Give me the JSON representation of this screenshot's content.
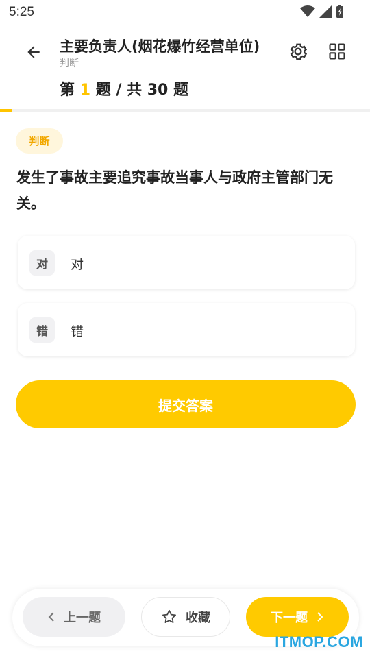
{
  "status_bar": {
    "time": "5:25"
  },
  "header": {
    "title": "主要负责人(烟花爆竹经营单位)",
    "subtitle": "判断",
    "progress": {
      "prefix": "第",
      "current": "1",
      "middle": "题 / 共",
      "total": "30",
      "suffix": "题"
    }
  },
  "progress_fraction": 0.033,
  "question": {
    "type_label": "判断",
    "text": "发生了事故主要追究事故当事人与政府主管部门无关。",
    "options": [
      {
        "key": "对",
        "text": "对"
      },
      {
        "key": "错",
        "text": "错"
      }
    ]
  },
  "submit_label": "提交答案",
  "bottom_nav": {
    "prev_label": "上一题",
    "fav_label": "收藏",
    "next_label": "下一题"
  },
  "watermark": "ITMOP.COM",
  "colors": {
    "accent": "#ffca00",
    "badge_bg": "#fff6dc",
    "badge_text": "#f2a800",
    "watermark": "#2aa6e0"
  }
}
